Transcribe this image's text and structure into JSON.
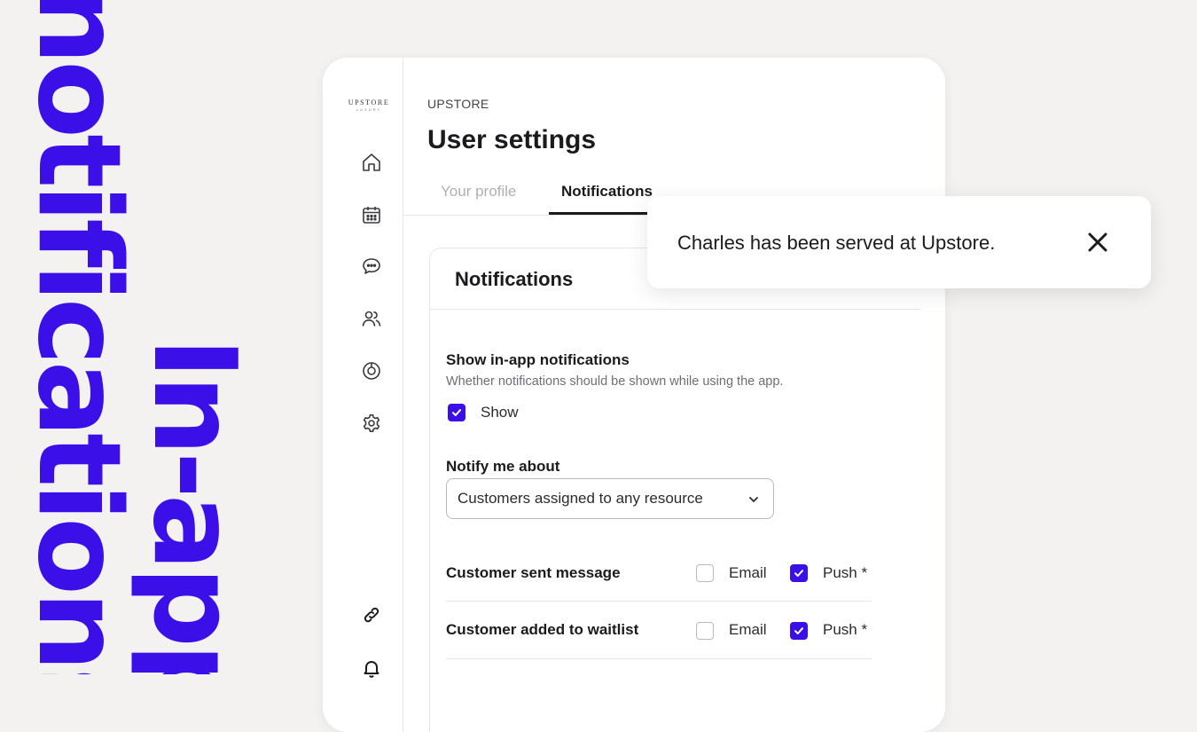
{
  "promo": {
    "line1": "notifications",
    "line2": "In-app"
  },
  "colors": {
    "accent": "#3b10e8",
    "background": "#f4f2f1"
  },
  "sidebar": {
    "logo_text": "UPSTORE",
    "logo_subtext": "LUXURY",
    "items": [
      {
        "icon": "home-icon"
      },
      {
        "icon": "calendar-icon"
      },
      {
        "icon": "chat-icon"
      },
      {
        "icon": "users-icon"
      },
      {
        "icon": "target-icon"
      },
      {
        "icon": "gear-icon"
      },
      {
        "icon": "link-icon"
      },
      {
        "icon": "bell-icon"
      }
    ]
  },
  "header": {
    "brand": "UPSTORE",
    "title": "User settings"
  },
  "tabs": [
    {
      "label": "Your profile",
      "active": false
    },
    {
      "label": "Notifications",
      "active": true
    }
  ],
  "card": {
    "title": "Notifications",
    "show_in_app": {
      "label": "Show in-app notifications",
      "helper": "Whether notifications should be shown while using the app.",
      "checkbox_label": "Show",
      "checked": true
    },
    "notify_about": {
      "label": "Notify me about",
      "selected": "Customers assigned to any resource"
    },
    "rows": [
      {
        "label": "Customer sent message",
        "email_label": "Email",
        "email": false,
        "push_label": "Push *",
        "push": true
      },
      {
        "label": "Customer added to waitlist",
        "email_label": "Email",
        "email": false,
        "push_label": "Push *",
        "push": true
      }
    ]
  },
  "toast": {
    "message": "Charles has been served at Upstore."
  }
}
